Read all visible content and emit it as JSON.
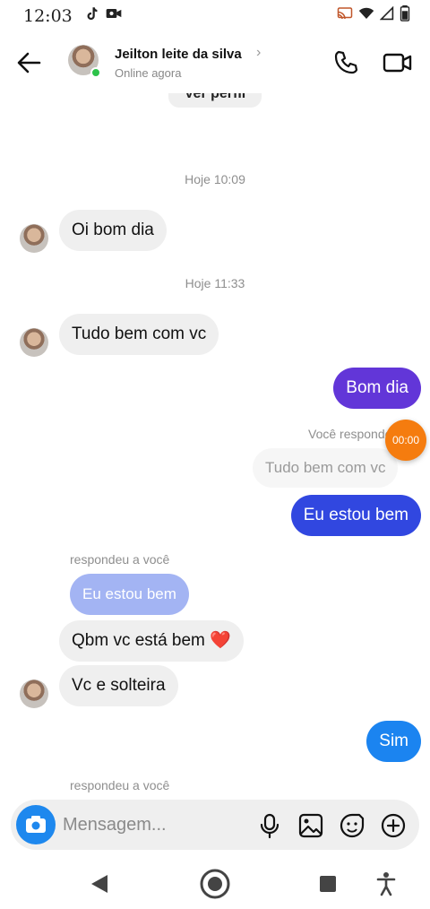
{
  "status_bar": {
    "time": "12:03"
  },
  "header": {
    "contact_name": "Jeilton leite da silva",
    "contact_status": "Online agora"
  },
  "chat": {
    "ver_perfil": "Ver perfil",
    "timestamps": [
      "Hoje 10:09",
      "Hoje 11:33"
    ],
    "messages": [
      {
        "from": "them",
        "text": "Oi bom dia"
      },
      {
        "from": "them",
        "text": "Tudo bem com vc"
      },
      {
        "from": "me",
        "text": "Bom dia"
      },
      {
        "from": "me",
        "reply_label": "Você respondeu",
        "quoted": "Tudo bem com vc",
        "text": "Eu estou bem"
      },
      {
        "from": "them",
        "reply_label": "respondeu a você",
        "quoted": "Eu estou bem",
        "text": "Qbm vc está bem ❤️"
      },
      {
        "from": "them",
        "text": "Vc e solteira"
      },
      {
        "from": "me",
        "text": "Sim"
      },
      {
        "from": "them",
        "reply_label": "respondeu a você"
      }
    ],
    "timer": "00:00"
  },
  "composer": {
    "placeholder": "Mensagem..."
  },
  "colors": {
    "bubble_out_top": "#6236d8",
    "bubble_out_mid": "#3147e0",
    "bubble_out_bottom": "#1b84f0",
    "bubble_in": "#efefef",
    "online": "#2dc24a",
    "camera": "#1e88ee",
    "timer": "#f57c0f"
  },
  "icons": {
    "status_left": [
      "tiktok-icon",
      "video-record-icon"
    ],
    "status_right": [
      "cast-icon",
      "wifi-icon",
      "signal-icon",
      "battery-icon"
    ],
    "composer": [
      "microphone-icon",
      "gallery-icon",
      "sticker-icon",
      "plus-icon"
    ],
    "nav": [
      "back-triangle-icon",
      "home-circle-icon",
      "recents-square-icon",
      "accessibility-icon"
    ]
  }
}
